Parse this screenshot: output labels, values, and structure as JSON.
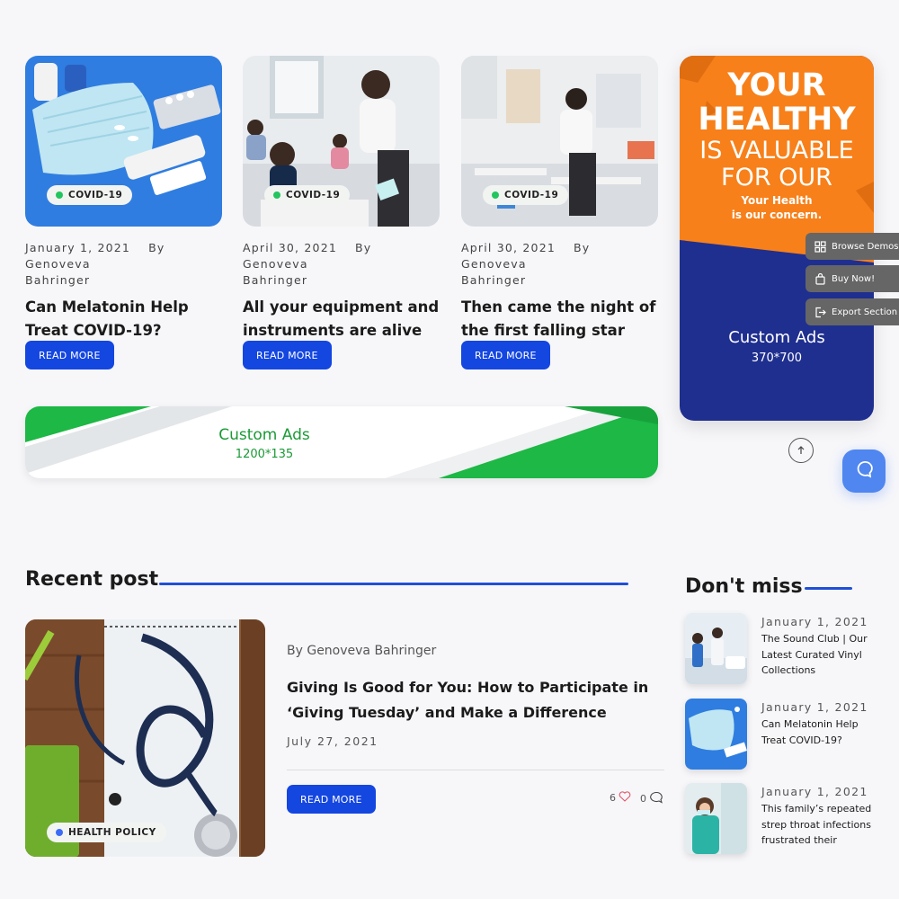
{
  "cards": [
    {
      "badge": "COVID-19",
      "date": "January 1, 2021",
      "author": "By Genoveva",
      "author2": "Bahringer",
      "title": "Can Melatonin Help Treat COVID-19?",
      "button": "READ MORE"
    },
    {
      "badge": "COVID-19",
      "date": "April 30, 2021",
      "author": "By Genoveva",
      "author2": "Bahringer",
      "title": "All your equipment and instruments are alive",
      "button": "READ MORE"
    },
    {
      "badge": "COVID-19",
      "date": "April 30, 2021",
      "author": "By Genoveva",
      "author2": "Bahringer",
      "title": "Then came the night of the first falling star",
      "button": "READ MORE"
    }
  ],
  "side_ad": {
    "line1": "YOUR",
    "line2": "HEALTHY",
    "line3": "IS VALUABLE",
    "line4": "FOR OUR",
    "tag1": "Your Health",
    "tag2": "is our concern.",
    "label": "Custom Ads",
    "size": "370*700"
  },
  "wide_ad": {
    "label": "Custom Ads",
    "size": "1200*135"
  },
  "floating": {
    "browse": "Browse Demos",
    "buy": "Buy Now!",
    "export": "Export Section"
  },
  "recent": {
    "heading": "Recent post",
    "badge": "HEALTH POLICY",
    "author": "By Genoveva Bahringer",
    "title": "Giving Is Good for You: How to Participate in ‘Giving Tuesday’ and Make a Difference",
    "date": "July 27, 2021",
    "button": "READ MORE",
    "likes": "6",
    "comments": "0"
  },
  "dont_miss": {
    "heading": "Don't miss",
    "items": [
      {
        "date": "January 1, 2021",
        "title": "The Sound Club | Our Latest Curated Vinyl Collections"
      },
      {
        "date": "January 1, 2021",
        "title": "Can Melatonin Help Treat COVID-19?"
      },
      {
        "date": "January 1, 2021",
        "title": "This family’s repeated strep throat infections frustrated their"
      }
    ]
  },
  "colors": {
    "primary": "#1446e0",
    "accent_green": "#22c55e",
    "ad_orange": "#f7801a",
    "ad_navy": "#1f2f8f"
  }
}
